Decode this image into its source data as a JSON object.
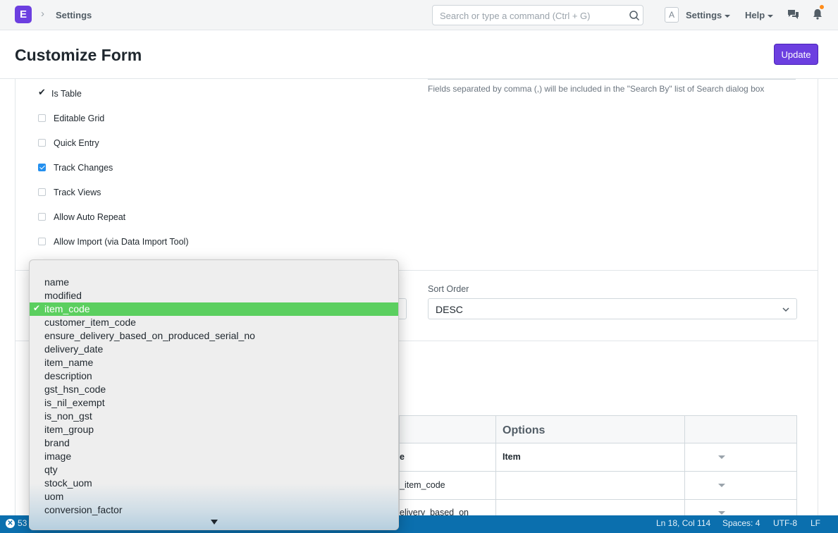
{
  "navbar": {
    "logo_letter": "E",
    "breadcrumb": "Settings",
    "search_placeholder": "Search or type a command (Ctrl + G)",
    "avatar_letter": "A",
    "menus": [
      "Settings",
      "Help"
    ],
    "icons": [
      "search-icon",
      "chat-icon",
      "bell-icon"
    ],
    "accent_color": "#6c3fe0",
    "notification_dot_color": "#ff8c1a"
  },
  "page": {
    "title": "Customize Form",
    "update_label": "Update"
  },
  "form": {
    "search_fields_help": "Fields separated by comma (,) will be included in the \"Search By\" list of Search dialog box",
    "checkboxes": [
      {
        "label": "Is Table",
        "checked": true,
        "style": "tick"
      },
      {
        "label": "Editable Grid",
        "checked": false
      },
      {
        "label": "Quick Entry",
        "checked": false
      },
      {
        "label": "Track Changes",
        "checked": true
      },
      {
        "label": "Track Views",
        "checked": false
      },
      {
        "label": "Allow Auto Repeat",
        "checked": false
      },
      {
        "label": "Allow Import (via Data Import Tool)",
        "checked": false
      }
    ],
    "sort_order_label": "Sort Order",
    "sort_order_value": "DESC"
  },
  "fields_table": {
    "header_options": "Options",
    "rows": [
      {
        "type_fragment": "e",
        "options": "Item"
      },
      {
        "type_fragment": "_item_code",
        "options": ""
      },
      {
        "type_fragment": "elivery_based_on",
        "options": ""
      }
    ]
  },
  "dropdown": {
    "selected": "item_code",
    "items": [
      "name",
      "modified",
      "item_code",
      "customer_item_code",
      "ensure_delivery_based_on_produced_serial_no",
      "delivery_date",
      "item_name",
      "description",
      "gst_hsn_code",
      "is_nil_exempt",
      "is_non_gst",
      "item_group",
      "brand",
      "image",
      "qty",
      "stock_uom",
      "uom",
      "conversion_factor"
    ],
    "selected_color": "#5bcf5f"
  },
  "status_bar": {
    "error_count": "53",
    "cursor": "Ln 18, Col 114",
    "spaces": "Spaces: 4",
    "encoding": "UTF-8",
    "line_ending": "LF",
    "background_color": "#0b6fae"
  }
}
